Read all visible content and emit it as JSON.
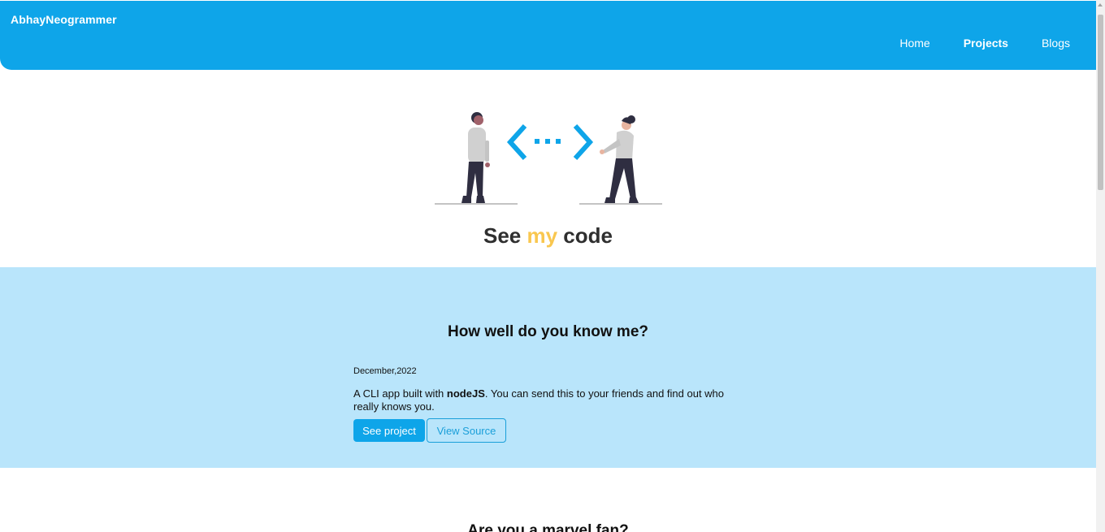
{
  "navbar": {
    "brand": "AbhayNeogrammer",
    "links": [
      {
        "label": "Home"
      },
      {
        "label": "Projects"
      },
      {
        "label": "Blogs"
      }
    ]
  },
  "hero": {
    "title_part1": "See ",
    "title_accent": "my",
    "title_part2": " code",
    "accent_color": "#f9c74f"
  },
  "projects": [
    {
      "title": "How well do you know me?",
      "date": "December,2022",
      "desc_prefix": "A CLI app built with ",
      "desc_bold": "nodeJS",
      "desc_suffix": ". You can send this to your friends and find out who really knows you.",
      "primary_label": "See project",
      "secondary_label": "View Source"
    },
    {
      "title": "Are you a marvel fan?"
    }
  ],
  "colors": {
    "primary": "#0ea5e9",
    "section_bg": "#b9e5fb"
  }
}
